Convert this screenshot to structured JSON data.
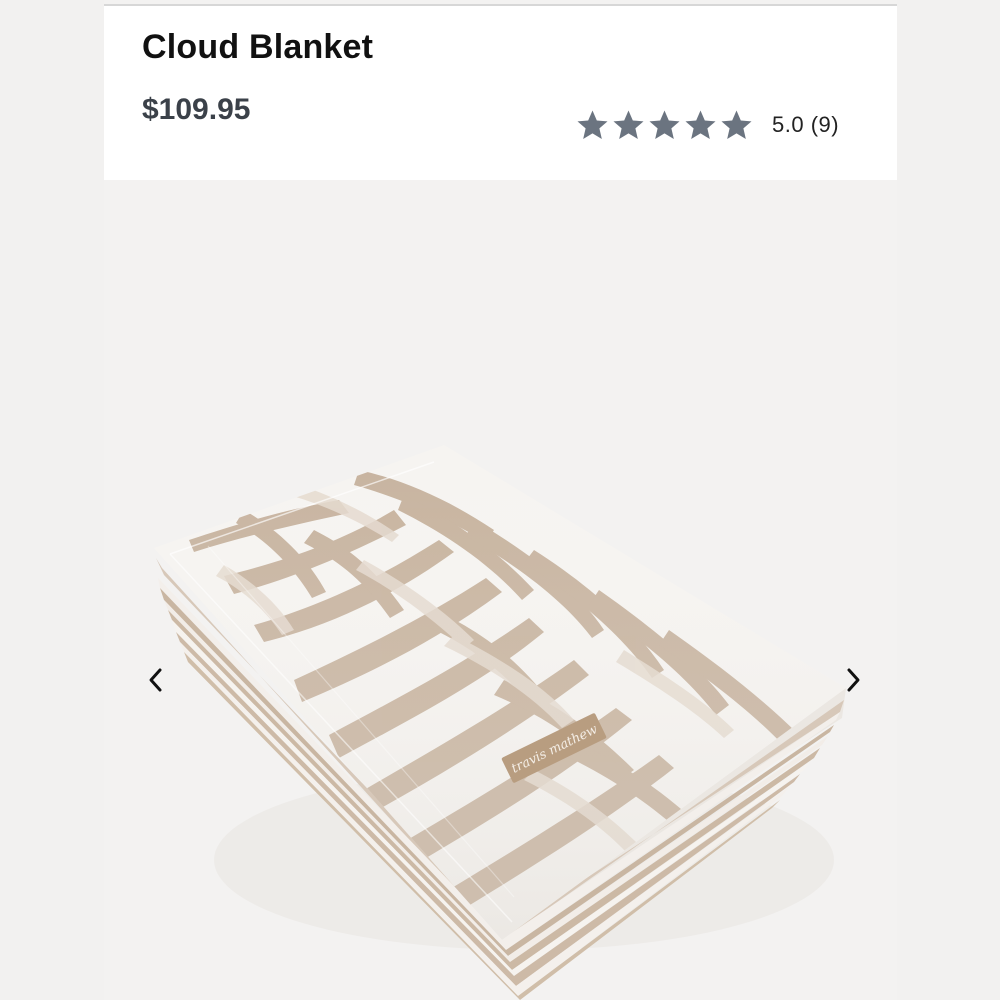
{
  "product": {
    "title": "Cloud Blanket",
    "price": "$109.95"
  },
  "rating": {
    "score_text": "5.0",
    "count_text": "(9)",
    "value": 5,
    "max": 5,
    "star_color": "#6b7480"
  },
  "gallery": {
    "image_name": "cloud-blanket-product-photo",
    "brand_label_text": "travis mathew",
    "prev_icon": "chevron-left-icon",
    "next_icon": "chevron-right-icon"
  },
  "colors": {
    "header_bg": "#ffffff",
    "gallery_bg": "#f3f2f1",
    "blanket_tan": "#c1ab95",
    "blanket_white": "#f8f7f5",
    "label_tan": "#b89d80"
  }
}
